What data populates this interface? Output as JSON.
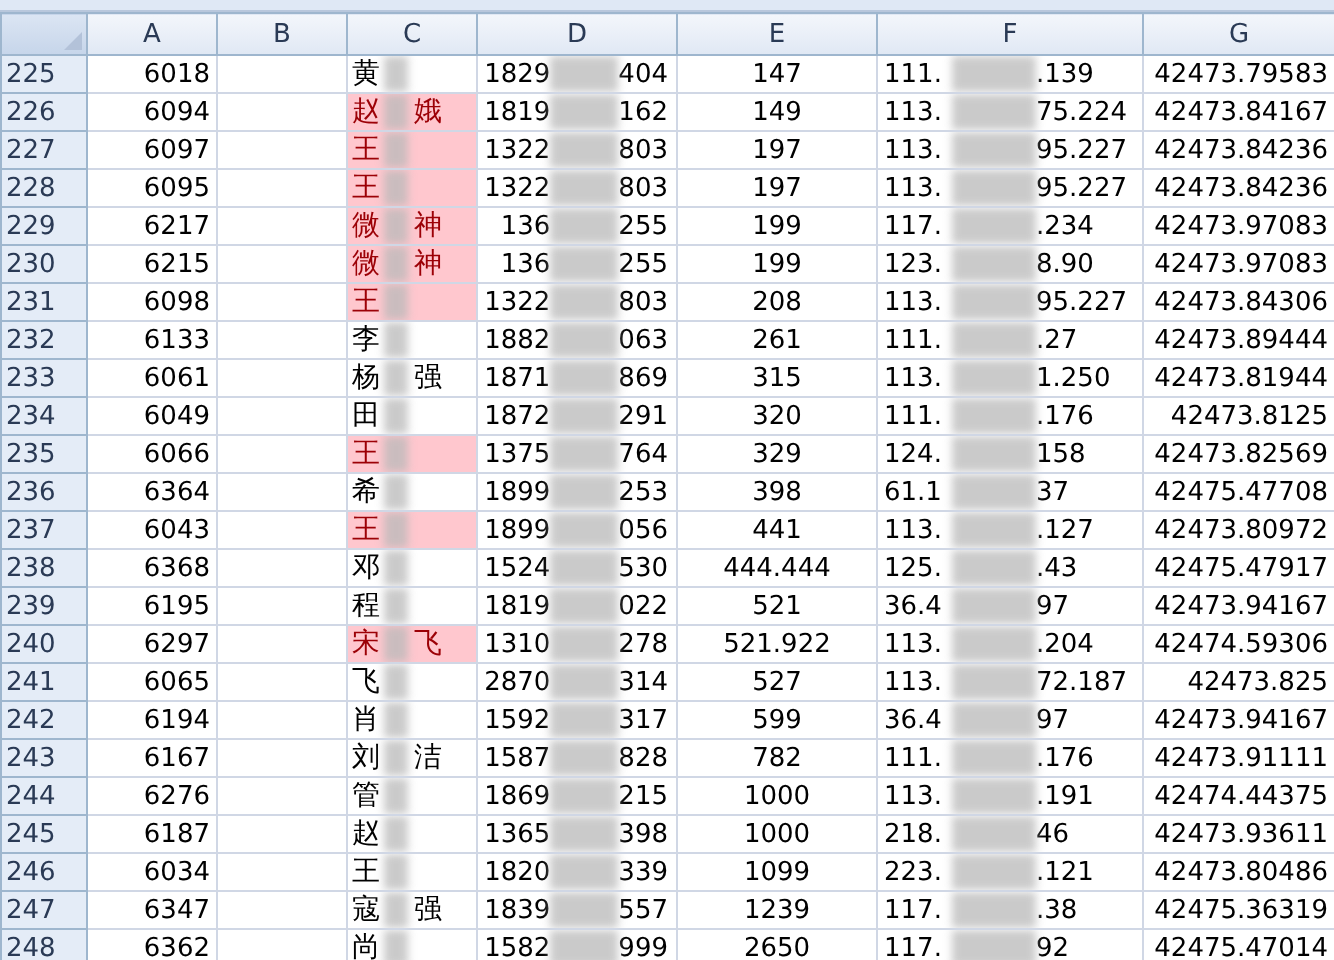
{
  "columns": [
    "A",
    "B",
    "C",
    "D",
    "E",
    "F",
    "G"
  ],
  "rows": [
    {
      "num": "225",
      "a": "6018",
      "surname": "黄",
      "given": "",
      "d_head": "1829",
      "d_tail": "404",
      "e": "147",
      "f_head": "111.",
      "f_tail": ".139",
      "g": "42473.79583",
      "highlighted": false
    },
    {
      "num": "226",
      "a": "6094",
      "surname": "赵",
      "given": "娥",
      "d_head": "1819",
      "d_tail": "162",
      "e": "149",
      "f_head": "113.",
      "f_tail": "75.224",
      "g": "42473.84167",
      "highlighted": true
    },
    {
      "num": "227",
      "a": "6097",
      "surname": "王",
      "given": "",
      "d_head": "1322",
      "d_tail": "803",
      "e": "197",
      "f_head": "113.",
      "f_tail": "95.227",
      "g": "42473.84236",
      "highlighted": true
    },
    {
      "num": "228",
      "a": "6095",
      "surname": "王",
      "given": "",
      "d_head": "1322",
      "d_tail": "803",
      "e": "197",
      "f_head": "113.",
      "f_tail": "95.227",
      "g": "42473.84236",
      "highlighted": true
    },
    {
      "num": "229",
      "a": "6217",
      "surname": "微",
      "given": "神",
      "d_head": "136",
      "d_tail": "255",
      "e": "199",
      "f_head": "117.",
      "f_tail": ".234",
      "g": "42473.97083",
      "highlighted": true
    },
    {
      "num": "230",
      "a": "6215",
      "surname": "微",
      "given": "神",
      "d_head": "136",
      "d_tail": "255",
      "e": "199",
      "f_head": "123.",
      "f_tail": "8.90",
      "g": "42473.97083",
      "highlighted": true
    },
    {
      "num": "231",
      "a": "6098",
      "surname": "王",
      "given": "",
      "d_head": "1322",
      "d_tail": "803",
      "e": "208",
      "f_head": "113.",
      "f_tail": "95.227",
      "g": "42473.84306",
      "highlighted": true
    },
    {
      "num": "232",
      "a": "6133",
      "surname": "李",
      "given": "",
      "d_head": "1882",
      "d_tail": "063",
      "e": "261",
      "f_head": "111.",
      "f_tail": ".27",
      "g": "42473.89444",
      "highlighted": false
    },
    {
      "num": "233",
      "a": "6061",
      "surname": "杨",
      "given": "强",
      "d_head": "1871",
      "d_tail": "869",
      "e": "315",
      "f_head": "113.",
      "f_tail": "1.250",
      "g": "42473.81944",
      "highlighted": false
    },
    {
      "num": "234",
      "a": "6049",
      "surname": "田",
      "given": "",
      "d_head": "1872",
      "d_tail": "291",
      "e": "320",
      "f_head": "111.",
      "f_tail": ".176",
      "g": "42473.8125",
      "highlighted": false
    },
    {
      "num": "235",
      "a": "6066",
      "surname": "王",
      "given": "",
      "d_head": "1375",
      "d_tail": "764",
      "e": "329",
      "f_head": "124.",
      "f_tail": "158",
      "g": "42473.82569",
      "highlighted": true
    },
    {
      "num": "236",
      "a": "6364",
      "surname": "希",
      "given": "",
      "d_head": "1899",
      "d_tail": "253",
      "e": "398",
      "f_head": "61.1",
      "f_tail": "37",
      "g": "42475.47708",
      "highlighted": false
    },
    {
      "num": "237",
      "a": "6043",
      "surname": "王",
      "given": "",
      "d_head": "1899",
      "d_tail": "056",
      "e": "441",
      "f_head": "113.",
      "f_tail": ".127",
      "g": "42473.80972",
      "highlighted": true
    },
    {
      "num": "238",
      "a": "6368",
      "surname": "邓",
      "given": "",
      "d_head": "1524",
      "d_tail": "530",
      "e": "444.444",
      "f_head": "125.",
      "f_tail": ".43",
      "g": "42475.47917",
      "highlighted": false
    },
    {
      "num": "239",
      "a": "6195",
      "surname": "程",
      "given": "",
      "d_head": "1819",
      "d_tail": "022",
      "e": "521",
      "f_head": "36.4",
      "f_tail": "97",
      "g": "42473.94167",
      "highlighted": false
    },
    {
      "num": "240",
      "a": "6297",
      "surname": "宋",
      "given": "飞",
      "d_head": "1310",
      "d_tail": "278",
      "e": "521.922",
      "f_head": "113.",
      "f_tail": ".204",
      "g": "42474.59306",
      "highlighted": true
    },
    {
      "num": "241",
      "a": "6065",
      "surname": "飞",
      "given": "",
      "d_head": "2870",
      "d_tail": "314",
      "e": "527",
      "f_head": "113.",
      "f_tail": "72.187",
      "g": "42473.825",
      "highlighted": false
    },
    {
      "num": "242",
      "a": "6194",
      "surname": "肖",
      "given": "",
      "d_head": "1592",
      "d_tail": "317",
      "e": "599",
      "f_head": "36.4",
      "f_tail": "97",
      "g": "42473.94167",
      "highlighted": false
    },
    {
      "num": "243",
      "a": "6167",
      "surname": "刘",
      "given": "洁",
      "d_head": "1587",
      "d_tail": "828",
      "e": "782",
      "f_head": "111.",
      "f_tail": ".176",
      "g": "42473.91111",
      "highlighted": false
    },
    {
      "num": "244",
      "a": "6276",
      "surname": "管",
      "given": "",
      "d_head": "1869",
      "d_tail": "215",
      "e": "1000",
      "f_head": "113.",
      "f_tail": ".191",
      "g": "42474.44375",
      "highlighted": false
    },
    {
      "num": "245",
      "a": "6187",
      "surname": "赵",
      "given": "",
      "d_head": "1365",
      "d_tail": "398",
      "e": "1000",
      "f_head": "218.",
      "f_tail": "46",
      "g": "42473.93611",
      "highlighted": false
    },
    {
      "num": "246",
      "a": "6034",
      "surname": "王",
      "given": "",
      "d_head": "1820",
      "d_tail": "339",
      "e": "1099",
      "f_head": "223.",
      "f_tail": ".121",
      "g": "42473.80486",
      "highlighted": false
    },
    {
      "num": "247",
      "a": "6347",
      "surname": "寇",
      "given": "强",
      "d_head": "1839",
      "d_tail": "557",
      "e": "1239",
      "f_head": "117.",
      "f_tail": ".38",
      "g": "42475.36319",
      "highlighted": false
    },
    {
      "num": "248",
      "a": "6362",
      "surname": "尚",
      "given": "",
      "d_head": "1582",
      "d_tail": "999",
      "e": "2650",
      "f_head": "117.",
      "f_tail": "92",
      "g": "42475.47014",
      "highlighted": false
    }
  ]
}
